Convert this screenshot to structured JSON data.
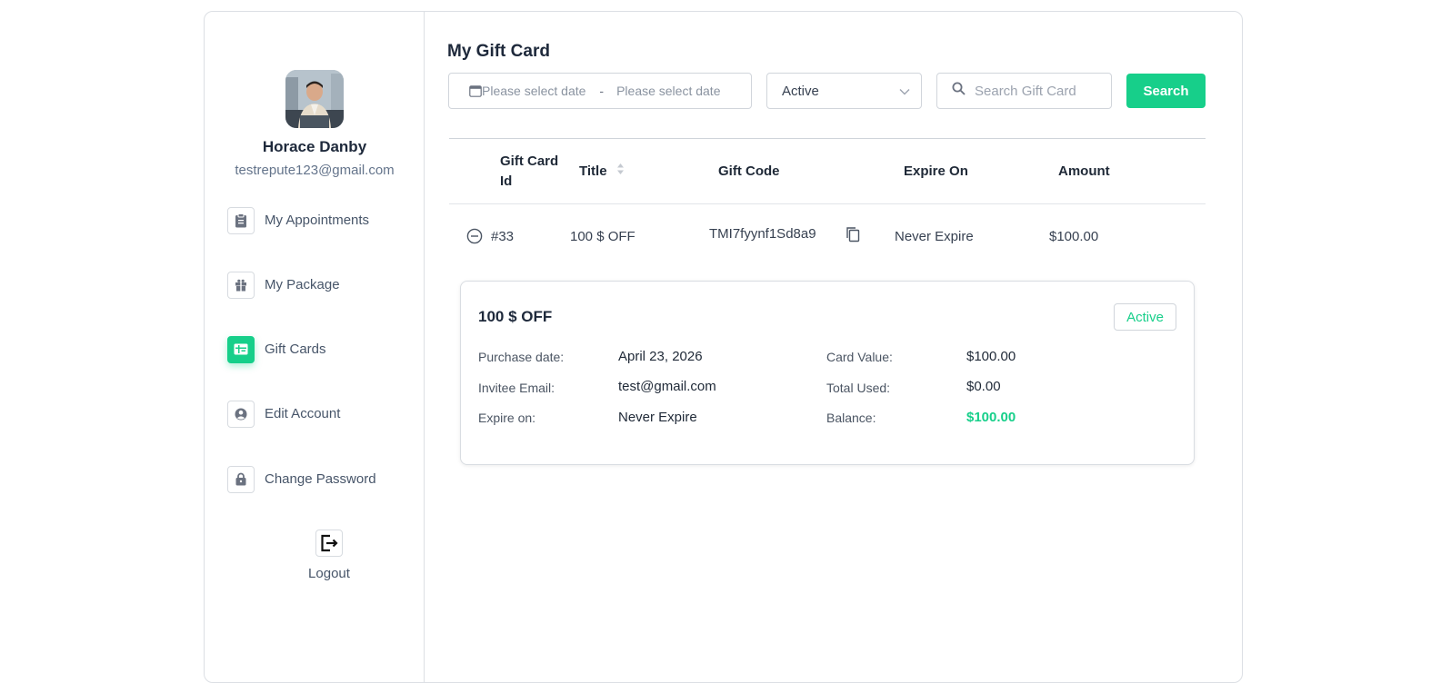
{
  "user": {
    "name": "Horace Danby",
    "email": "testrepute123@gmail.com"
  },
  "sidebar": {
    "items": [
      {
        "label": "My Appointments",
        "icon": "clipboard-icon"
      },
      {
        "label": "My Package",
        "icon": "gift-icon"
      },
      {
        "label": "Gift Cards",
        "icon": "gift-card-icon",
        "active": true
      },
      {
        "label": "Edit Account",
        "icon": "user-circle-icon"
      },
      {
        "label": "Change Password",
        "icon": "lock-icon"
      }
    ],
    "logout_label": "Logout"
  },
  "main": {
    "title": "My Gift Card",
    "filters": {
      "start_date_placeholder": "Please select date",
      "separator": "-",
      "end_date_placeholder": "Please select date",
      "status_value": "Active",
      "search_placeholder": "Search Gift Card",
      "search_button": "Search"
    },
    "table": {
      "headers": {
        "id_line1": "Gift Card",
        "id_line2": "Id",
        "title": "Title",
        "code": "Gift Code",
        "expire": "Expire On",
        "amount": "Amount"
      },
      "rows": [
        {
          "id": "#33",
          "title": "100 $ OFF",
          "code": "TMI7fyynf1Sd8a9",
          "expire": "Never Expire",
          "amount": "$100.00"
        }
      ]
    },
    "detail": {
      "title": "100 $ OFF",
      "status": "Active",
      "purchase_date_label": "Purchase date:",
      "purchase_date": "April 23, 2026",
      "invitee_email_label": "Invitee Email:",
      "invitee_email": "test@gmail.com",
      "expire_on_label": "Expire on:",
      "expire_on": "Never Expire",
      "card_value_label": "Card Value:",
      "card_value": "$100.00",
      "total_used_label": "Total Used:",
      "total_used": "$0.00",
      "balance_label": "Balance:",
      "balance": "$100.00"
    }
  },
  "colors": {
    "accent": "#17cf8a",
    "text_dark": "#1e293b",
    "text_muted": "#64748b",
    "border": "#dcdfe4"
  }
}
